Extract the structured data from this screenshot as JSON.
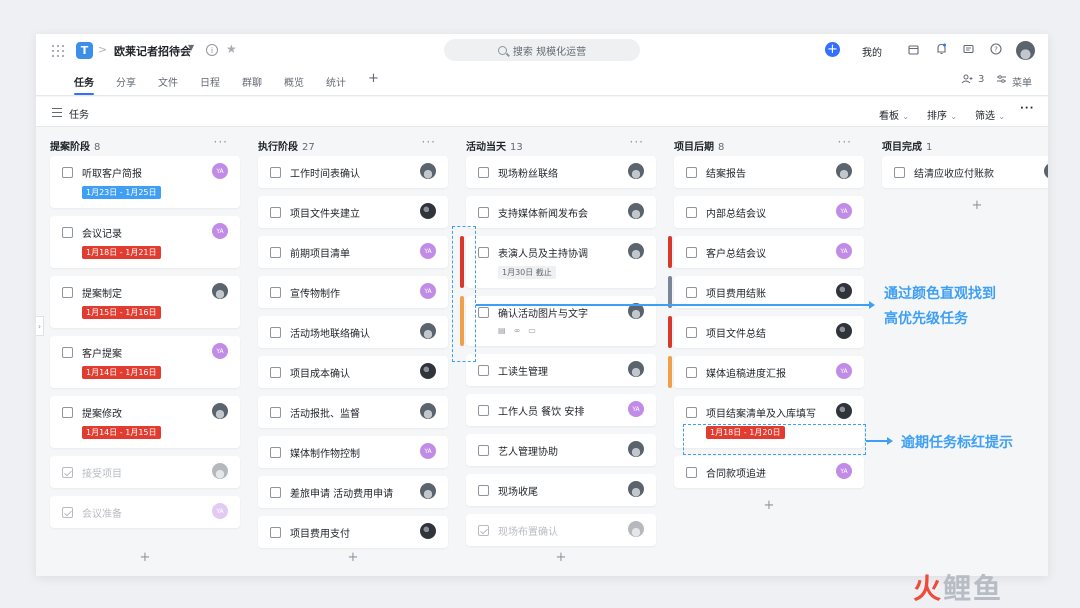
{
  "header": {
    "logo_letter": "T",
    "breadcrumb_sep": ">",
    "project_title": "欧莱记者招待会",
    "search_placeholder": "搜索 规模化运营",
    "my_label": "我的"
  },
  "tabs": [
    {
      "label": "任务",
      "active": true
    },
    {
      "label": "分享"
    },
    {
      "label": "文件"
    },
    {
      "label": "日程"
    },
    {
      "label": "群聊"
    },
    {
      "label": "概览"
    },
    {
      "label": "统计"
    }
  ],
  "tabs_right": {
    "member_count": "3",
    "menu_label": "菜单"
  },
  "toolbar": {
    "title": "任务",
    "view_label": "看板",
    "sort_label": "排序",
    "filter_label": "筛选"
  },
  "columns": [
    {
      "title": "提案阶段",
      "count": "8",
      "cards": [
        {
          "title": "听取客户简报",
          "avatar": "purple",
          "avatar_text": "YA",
          "date": "1月23日 - 1月25日",
          "date_color": "blue"
        },
        {
          "title": "会议记录",
          "avatar": "purple",
          "avatar_text": "YA",
          "date": "1月18日 - 1月21日",
          "date_color": "red"
        },
        {
          "title": "提案制定",
          "avatar": "photo",
          "date": "1月15日 - 1月16日",
          "date_color": "red"
        },
        {
          "title": "客户提案",
          "avatar": "purple",
          "avatar_text": "YA",
          "date": "1月14日 - 1月16日",
          "date_color": "red"
        },
        {
          "title": "提案修改",
          "avatar": "photo",
          "date": "1月14日 - 1月15日",
          "date_color": "red"
        },
        {
          "title": "接受项目",
          "avatar": "photo",
          "done": true
        },
        {
          "title": "会议准备",
          "avatar": "purple",
          "avatar_text": "YA",
          "done": true
        }
      ]
    },
    {
      "title": "执行阶段",
      "count": "27",
      "cards": [
        {
          "title": "工作时间表确认",
          "avatar": "photo"
        },
        {
          "title": "项目文件夹建立",
          "avatar": "dark"
        },
        {
          "title": "前期项目清单",
          "avatar": "purple",
          "avatar_text": "YA"
        },
        {
          "title": "宣传物制作",
          "avatar": "purple",
          "avatar_text": "YA"
        },
        {
          "title": "活动场地联络确认",
          "avatar": "photo"
        },
        {
          "title": "项目成本确认",
          "avatar": "dark"
        },
        {
          "title": "活动报批、监督",
          "avatar": "photo"
        },
        {
          "title": "媒体制作物控制",
          "avatar": "purple",
          "avatar_text": "YA"
        },
        {
          "title": "差旅申请 活动费用申请",
          "avatar": "photo"
        },
        {
          "title": "项目费用支付",
          "avatar": "dark"
        }
      ]
    },
    {
      "title": "活动当天",
      "count": "13",
      "cards": [
        {
          "title": "现场粉丝联络",
          "avatar": "photo"
        },
        {
          "title": "支持媒体新闻发布会",
          "avatar": "photo"
        },
        {
          "title": "表演人员及主持协调",
          "avatar": "photo",
          "strip": "red",
          "date": "1月30日 截止",
          "date_color": "gray"
        },
        {
          "title": "确认活动图片与文字",
          "avatar": "photo",
          "strip": "orange",
          "meta": true
        },
        {
          "title": "工读生管理",
          "avatar": "photo"
        },
        {
          "title": "工作人员 餐饮 安排",
          "avatar": "purple",
          "avatar_text": "YA"
        },
        {
          "title": "艺人管理协助",
          "avatar": "photo"
        },
        {
          "title": "现场收尾",
          "avatar": "photo"
        },
        {
          "title": "现场布置确认",
          "avatar": "photo",
          "done": true
        }
      ]
    },
    {
      "title": "项目后期",
      "count": "8",
      "cards": [
        {
          "title": "结案报告",
          "avatar": "photo"
        },
        {
          "title": "内部总结会议",
          "avatar": "purple",
          "avatar_text": "YA"
        },
        {
          "title": "客户总结会议",
          "avatar": "purple",
          "avatar_text": "YA",
          "strip": "red"
        },
        {
          "title": "项目费用结账",
          "avatar": "dark",
          "strip": "gray"
        },
        {
          "title": "项目文件总结",
          "avatar": "dark",
          "strip": "red"
        },
        {
          "title": "媒体追稿进度汇报",
          "avatar": "purple",
          "avatar_text": "YA",
          "strip": "orange"
        },
        {
          "title": "项目结案清单及入库填写",
          "avatar": "dark",
          "date": "1月18日 - 1月20日",
          "date_color": "red"
        },
        {
          "title": "合同款项追进",
          "avatar": "purple",
          "avatar_text": "YA"
        }
      ]
    },
    {
      "title": "项目完成",
      "count": "1",
      "cards": [
        {
          "title": "结清应收应付账款",
          "avatar": "photo"
        }
      ]
    }
  ],
  "annotations": {
    "priority_note_line1": "通过颜色直观找到",
    "priority_note_line2": "高优先级任务",
    "overdue_note": "逾期任务标红提示"
  },
  "watermark": {
    "part1": "火",
    "part2": "鲤鱼"
  },
  "colors": {
    "accent": "#3370ff",
    "annotation": "#3f9ff4",
    "overdue_red": "#e23b30",
    "date_blue": "#3f9ff4",
    "priority_orange": "#f0a04b",
    "avatar_purple": "#c08ce6"
  }
}
